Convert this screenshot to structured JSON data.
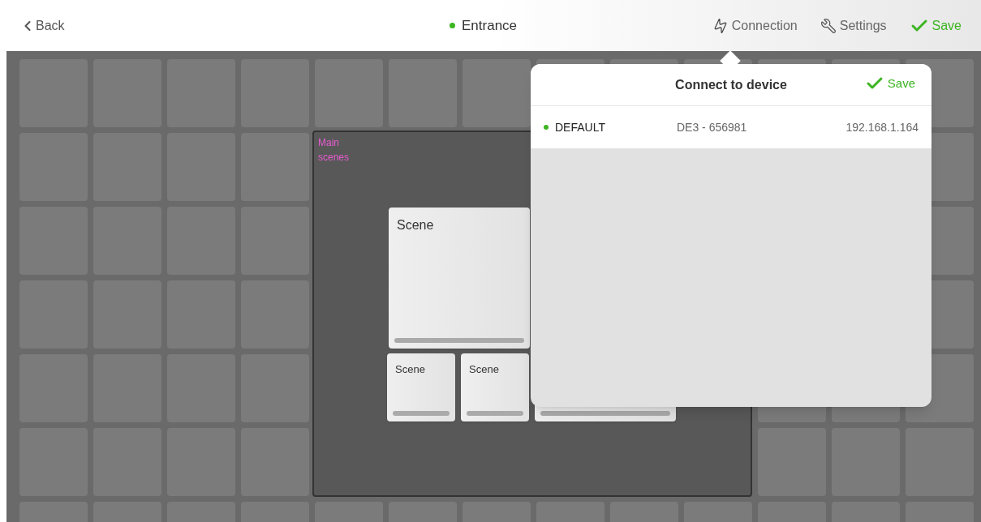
{
  "header": {
    "back": "Back",
    "title": "Entrance",
    "online": true,
    "actions": [
      {
        "label": "Connection",
        "kind": "connection"
      },
      {
        "label": "Settings",
        "kind": "settings"
      },
      {
        "label": "Save",
        "kind": "save"
      }
    ]
  },
  "canvas": {
    "group": {
      "title": "Main scenes",
      "scenes": [
        {
          "title": "Scene",
          "kind": "large"
        },
        {
          "title": "Scene",
          "kind": "small"
        },
        {
          "title": "Scene",
          "kind": "small"
        },
        {
          "kind": "wide"
        }
      ]
    }
  },
  "popover": {
    "title": "Connect to device",
    "save": "Save",
    "devices": [
      {
        "name": "DEFAULT",
        "online": true,
        "id": "DE3 - 656981",
        "address": "192.168.1.164"
      }
    ]
  }
}
